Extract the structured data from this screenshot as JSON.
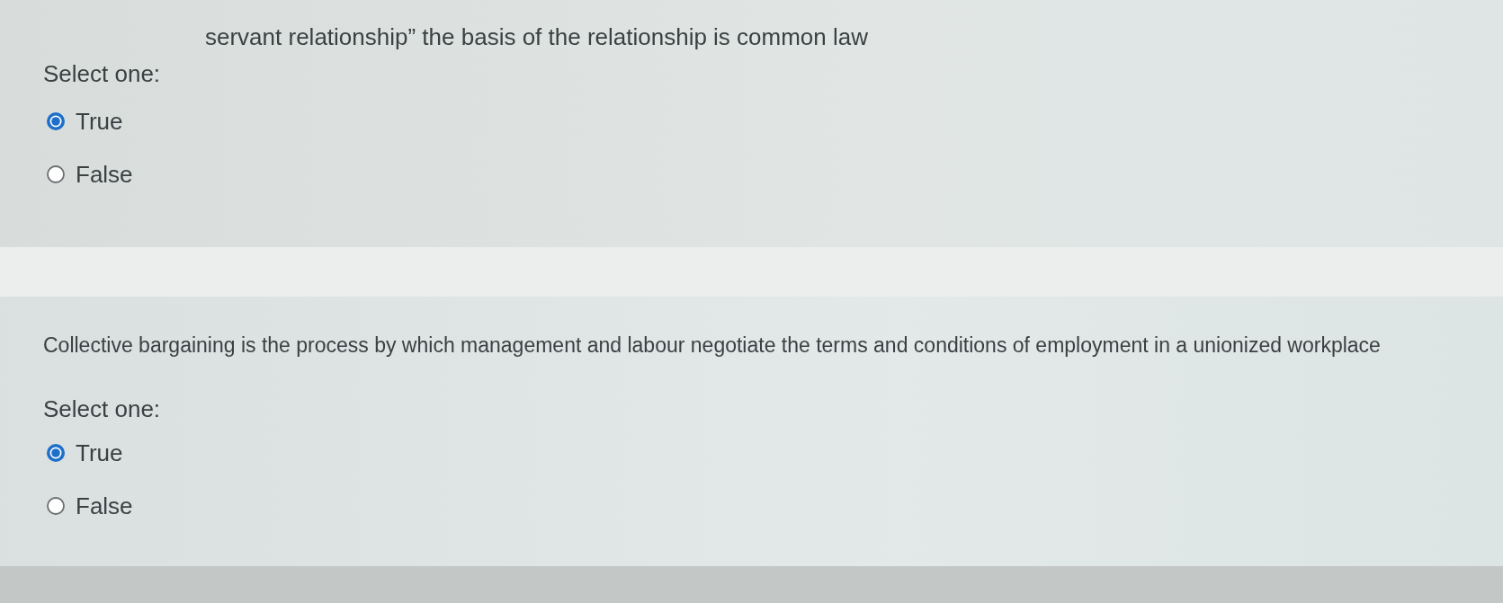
{
  "questions": [
    {
      "text": "servant relationship” the basis of the relationship is common law",
      "prompt": "Select one:",
      "options": [
        {
          "label": "True",
          "selected": true
        },
        {
          "label": "False",
          "selected": false
        }
      ]
    },
    {
      "text": "Collective bargaining is the process by which management and labour negotiate the terms and conditions of employment in a unionized workplace",
      "prompt": "Select one:",
      "options": [
        {
          "label": "True",
          "selected": true
        },
        {
          "label": "False",
          "selected": false
        }
      ]
    }
  ]
}
